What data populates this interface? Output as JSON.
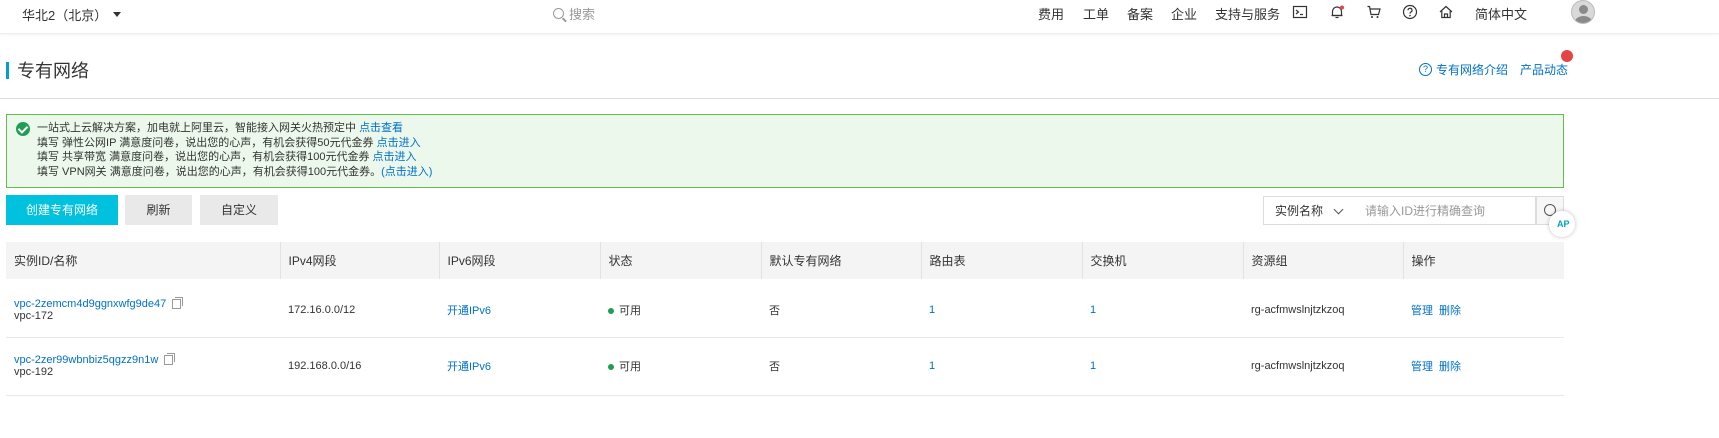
{
  "topbar": {
    "region": "华北2（北京）",
    "search_placeholder": "搜索",
    "nav": [
      "费用",
      "工单",
      "备案",
      "企业",
      "支持与服务"
    ],
    "icons": [
      "terminal-icon",
      "bell-icon",
      "cart-icon",
      "help-icon",
      "home-icon"
    ],
    "language": "简体中文"
  },
  "header": {
    "title": "专有网络",
    "intro_link": "专有网络介绍",
    "news_link": "产品动态"
  },
  "notice": {
    "line1_text": "一站式上云解决方案，加电就上阿里云，智能接入网关火热预定中 ",
    "line1_link": "点击查看",
    "line2_text": "填写 弹性公网IP 满意度问卷，说出您的心声，有机会获得50元代金券 ",
    "line2_link": "点击进入",
    "line3_text": "填写 共享带宽 满意度问卷，说出您的心声，有机会获得100元代金券 ",
    "line3_link": "点击进入",
    "line4_text": "填写 VPN网关 满意度问卷，说出您的心声，有机会获得100元代金券。",
    "line4_link": "(点击进入)"
  },
  "toolbar": {
    "create": "创建专有网络",
    "refresh": "刷新",
    "customize": "自定义",
    "filter_select": "实例名称",
    "filter_placeholder": "请输入ID进行精确查询",
    "api_badge": "AP"
  },
  "table": {
    "columns": [
      "实例ID/名称",
      "IPv4网段",
      "IPv6网段",
      "状态",
      "默认专有网络",
      "路由表",
      "交换机",
      "资源组",
      "操作"
    ],
    "rows": [
      {
        "id": "vpc-2zemcm4d9ggnxwfg9de47",
        "name": "vpc-172",
        "ipv4": "172.16.0.0/12",
        "ipv6": "开通IPv6",
        "status": "可用",
        "default": "否",
        "route": "1",
        "vswitch": "1",
        "rg": "rg-acfmwslnjtzkzoq",
        "manage": "管理",
        "delete": "删除"
      },
      {
        "id": "vpc-2zer99wbnbiz5qgzz9n1w",
        "name": "vpc-192",
        "ipv4": "192.168.0.0/16",
        "ipv6": "开通IPv6",
        "status": "可用",
        "default": "否",
        "route": "1",
        "vswitch": "1",
        "rg": "rg-acfmwslnjtzkzoq",
        "manage": "管理",
        "delete": "删除"
      }
    ]
  },
  "colors": {
    "accent": "#00c1de",
    "link": "#0070cc",
    "success": "#1e9e55",
    "notice_border": "#61c04b"
  }
}
